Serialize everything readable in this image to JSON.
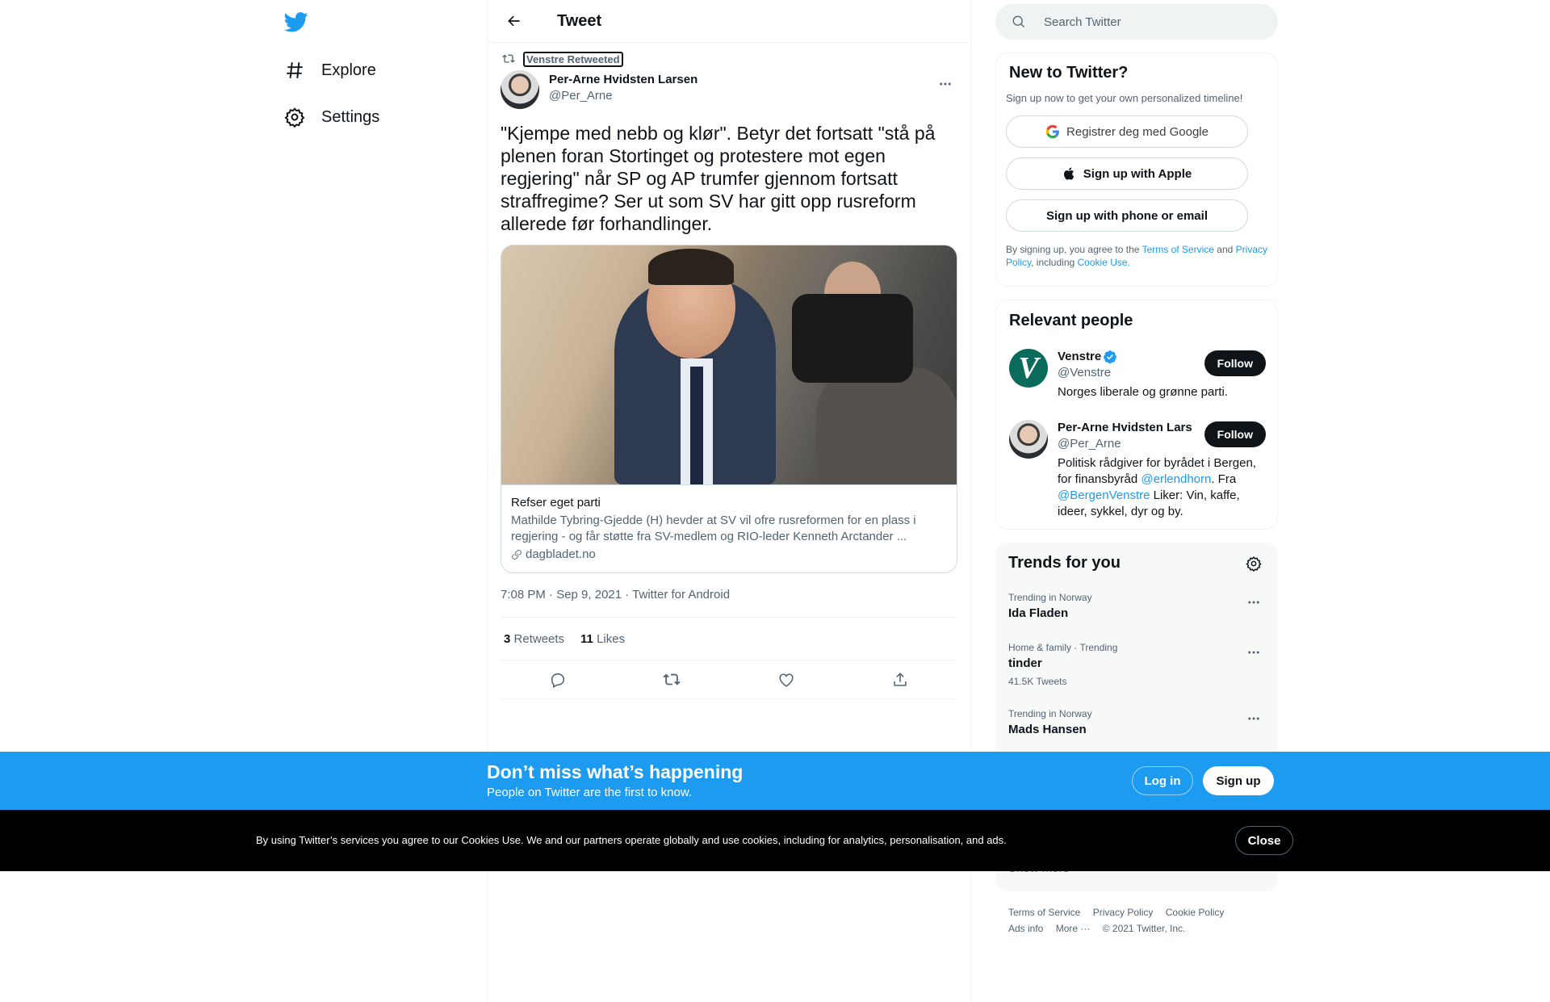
{
  "nav": {
    "explore_label": "Explore",
    "settings_label": "Settings"
  },
  "header": {
    "title": "Tweet"
  },
  "tweet": {
    "retweeted_by": "Venstre Retweeted",
    "author_name": "Per-Arne Hvidsten Larsen",
    "author_handle": "@Per_Arne",
    "text": "\"Kjempe med nebb og klør\". Betyr det fortsatt \"stå på plenen foran Stortinget og protestere mot egen regjering\" når SP og AP trumfer gjennom fortsatt straffregime? Ser ut som SV har gitt opp rusreform allerede før forhandlinger.",
    "card": {
      "title": "Refser eget parti",
      "description": "Mathilde Tybring-Gjedde (H) hevder at SV vil ofre rusreformen for en plass i regjering - og får støtte fra SV-medlem og RIO-leder Kenneth Arctander ...",
      "domain": "dagbladet.no"
    },
    "meta": "7:08 PM · Sep 9, 2021 · Twitter for Android",
    "retweets_count": "3",
    "retweets_label": "Retweets",
    "likes_count": "11",
    "likes_label": "Likes"
  },
  "search": {
    "placeholder": "Search Twitter"
  },
  "new_to_twitter": {
    "title": "New to Twitter?",
    "subtitle": "Sign up now to get your own personalized timeline!",
    "google_label": "Registrer deg med Google",
    "apple_label": "Sign up with Apple",
    "phone_label": "Sign up with phone or email",
    "legal_prefix": "By signing up, you agree to the",
    "terms_link": "Terms of Service",
    "legal_and": "and",
    "privacy_link": "Privacy Policy",
    "legal_including": ", including",
    "cookie_link": "Cookie Use."
  },
  "relevant_people": {
    "title": "Relevant people",
    "people": [
      {
        "name": "Venstre",
        "handle": "@Venstre",
        "bio": "Norges liberale og grønne parti.",
        "follow_label": "Follow",
        "avatar_letter": "V"
      },
      {
        "name": "Per-Arne Hvidsten Lars",
        "handle": "@Per_Arne",
        "bio_part1": "Politisk rådgiver for byrådet i Bergen, for finansbyråd ",
        "bio_link1": "@erlendhorn",
        "bio_part2": ". Fra ",
        "bio_link2": "@BergenVenstre",
        "bio_part3": " Liker: Vin, kaffe, ideer, sykkel, dyr og by.",
        "follow_label": "Follow"
      }
    ]
  },
  "trends": {
    "title": "Trends for you",
    "items": [
      {
        "context": "Trending in Norway",
        "name": "Ida Fladen",
        "count": ""
      },
      {
        "context": "Home & family · Trending",
        "name": "tinder",
        "count": "41.5K Tweets"
      },
      {
        "context": "Trending in Norway",
        "name": "Mads Hansen",
        "count": ""
      }
    ],
    "show_more": "Show more"
  },
  "footer": {
    "terms": "Terms of Service",
    "privacy": "Privacy Policy",
    "cookie": "Cookie Policy",
    "ads": "Ads info",
    "more": "More ···",
    "copyright": "© 2021 Twitter, Inc."
  },
  "signup_bar": {
    "title": "Don’t miss what’s happening",
    "subtitle": "People on Twitter are the first to know.",
    "login_label": "Log in",
    "signup_label": "Sign up"
  },
  "cookie_bar": {
    "text": "By using Twitter’s services you agree to our Cookies Use. We and our partners operate globally and use cookies, including for analytics, personalisation, and ads.",
    "close_label": "Close"
  },
  "colors": {
    "accent": "#1d9bf0",
    "text": "#0f1419",
    "secondary": "#536471"
  }
}
